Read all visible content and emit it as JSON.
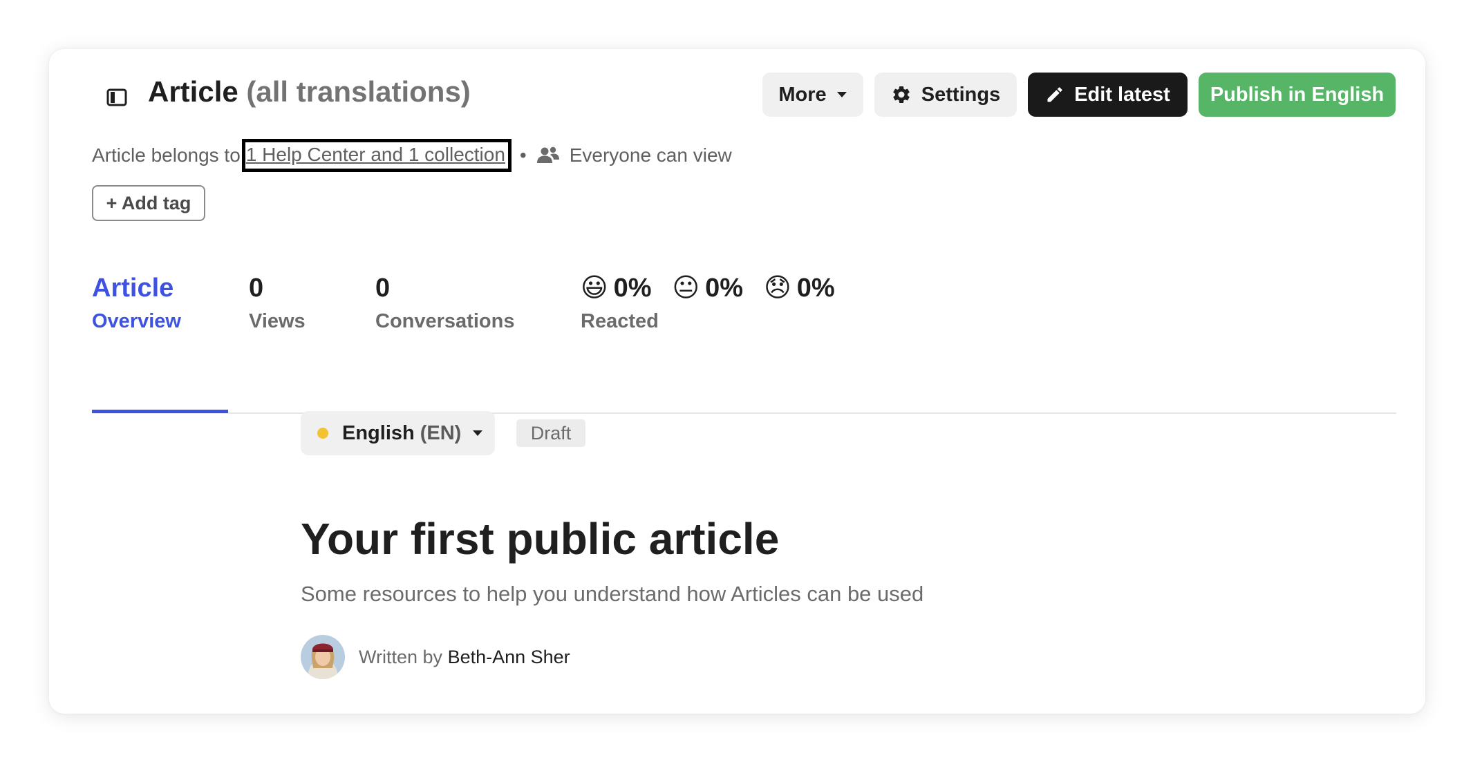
{
  "header": {
    "title": "Article",
    "title_suffix": "(all translations)",
    "more_label": "More",
    "settings_label": "Settings",
    "edit_label": "Edit latest",
    "publish_label": "Publish in English"
  },
  "meta": {
    "belongs_prefix": "Article belongs to",
    "belongs_link": "1 Help Center and 1 collection",
    "separator": "•",
    "visibility": "Everyone can view"
  },
  "tags": {
    "add_label": "+ Add tag"
  },
  "tabs": {
    "overview": {
      "top": "Article",
      "bottom": "Overview"
    },
    "views": {
      "value": "0",
      "label": "Views"
    },
    "conversations": {
      "value": "0",
      "label": "Conversations"
    },
    "reacted": {
      "label": "Reacted",
      "items": [
        {
          "emoji": "😃",
          "value": "0%"
        },
        {
          "emoji": "😐",
          "value": "0%"
        },
        {
          "emoji": "😞",
          "value": "0%"
        }
      ]
    }
  },
  "language": {
    "name": "English",
    "code": "(EN)",
    "status": "Draft"
  },
  "article": {
    "title": "Your first public article",
    "description": "Some resources to help you understand how Articles can be used",
    "written_by": "Written by",
    "author": "Beth-Ann Sher"
  },
  "colors": {
    "accent": "#3d52e0",
    "publish": "#57b567",
    "edit": "#1a1a1a",
    "draft_dot": "#f2c230"
  }
}
